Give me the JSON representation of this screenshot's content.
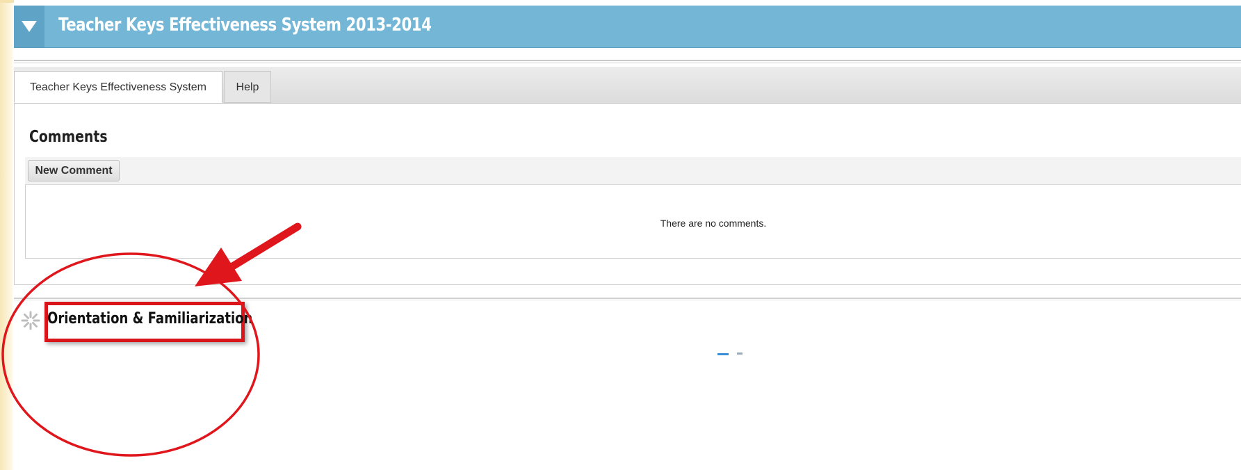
{
  "header": {
    "title": "Teacher Keys Effectiveness System 2013-2014",
    "toggle_icon": "triangle-down-icon",
    "background_color": "#74b6d6"
  },
  "tabs": [
    {
      "label": "Teacher Keys Effectiveness System",
      "active": true
    },
    {
      "label": "Help",
      "active": false
    }
  ],
  "comments": {
    "heading": "Comments",
    "new_comment_label": "New Comment",
    "empty_message": "There are no comments."
  },
  "section": {
    "title": "Orientation & Familiarization",
    "icon": "spinner-icon"
  },
  "annotation": {
    "color": "#e0161d",
    "shapes": [
      "ellipse",
      "arrow",
      "highlight-box"
    ]
  }
}
